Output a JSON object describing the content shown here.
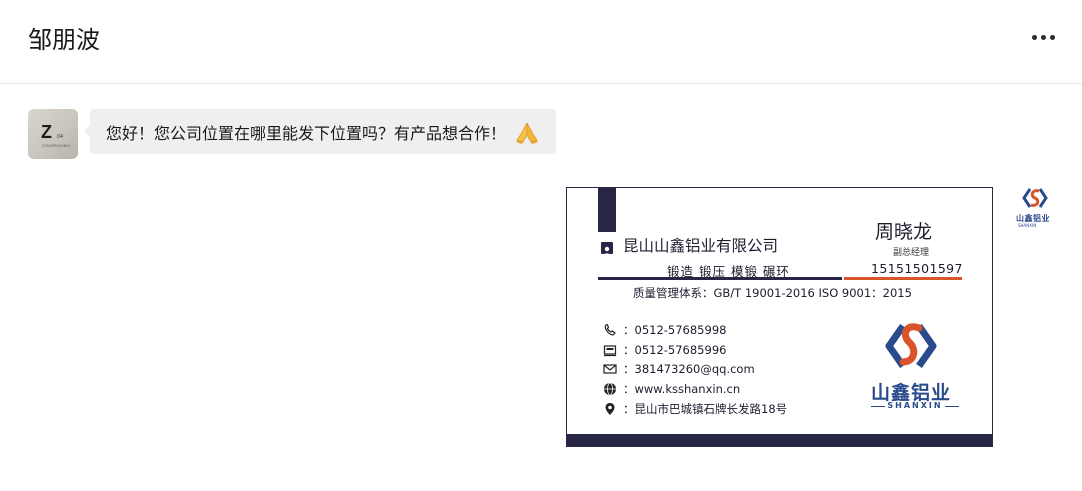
{
  "header": {
    "title": "邹朋波",
    "more_icon": "more-horizontal-icon"
  },
  "messages": [
    {
      "sender": "contact",
      "avatar": {
        "letter": "Z",
        "tiny": ".04",
        "sub": "ZOUPENGBO"
      },
      "text": "您好！您公司位置在哪里能发下位置吗？有产品想合作！",
      "emoji": "folded-hands-emoji"
    },
    {
      "sender": "self",
      "type": "image",
      "image": "business-card",
      "self_avatar": {
        "text": "山鑫铝业",
        "sub": "SHANXIN"
      }
    }
  ],
  "card": {
    "company": "昆山山鑫铝业有限公司",
    "services": "锻造  锻压  模锻  碾环",
    "contact_name": "周晓龙",
    "contact_title": "副总经理",
    "mobile": "15151501597",
    "quality_system": "质量管理体系：GB/T 19001-2016   ISO 9001：2015",
    "phone": "：0512-57685998",
    "fax": "：0512-57685996",
    "email": "：381473260@qq.com",
    "website": "：www.ksshanxin.cn",
    "address": "：昆山市巴城镇石牌长发路18号",
    "logo_text": "山鑫铝业",
    "logo_sub": "SHANXIN",
    "colors": {
      "navy": "#282645",
      "accent": "#d9532b",
      "brand_blue": "#2a4a8c"
    }
  }
}
